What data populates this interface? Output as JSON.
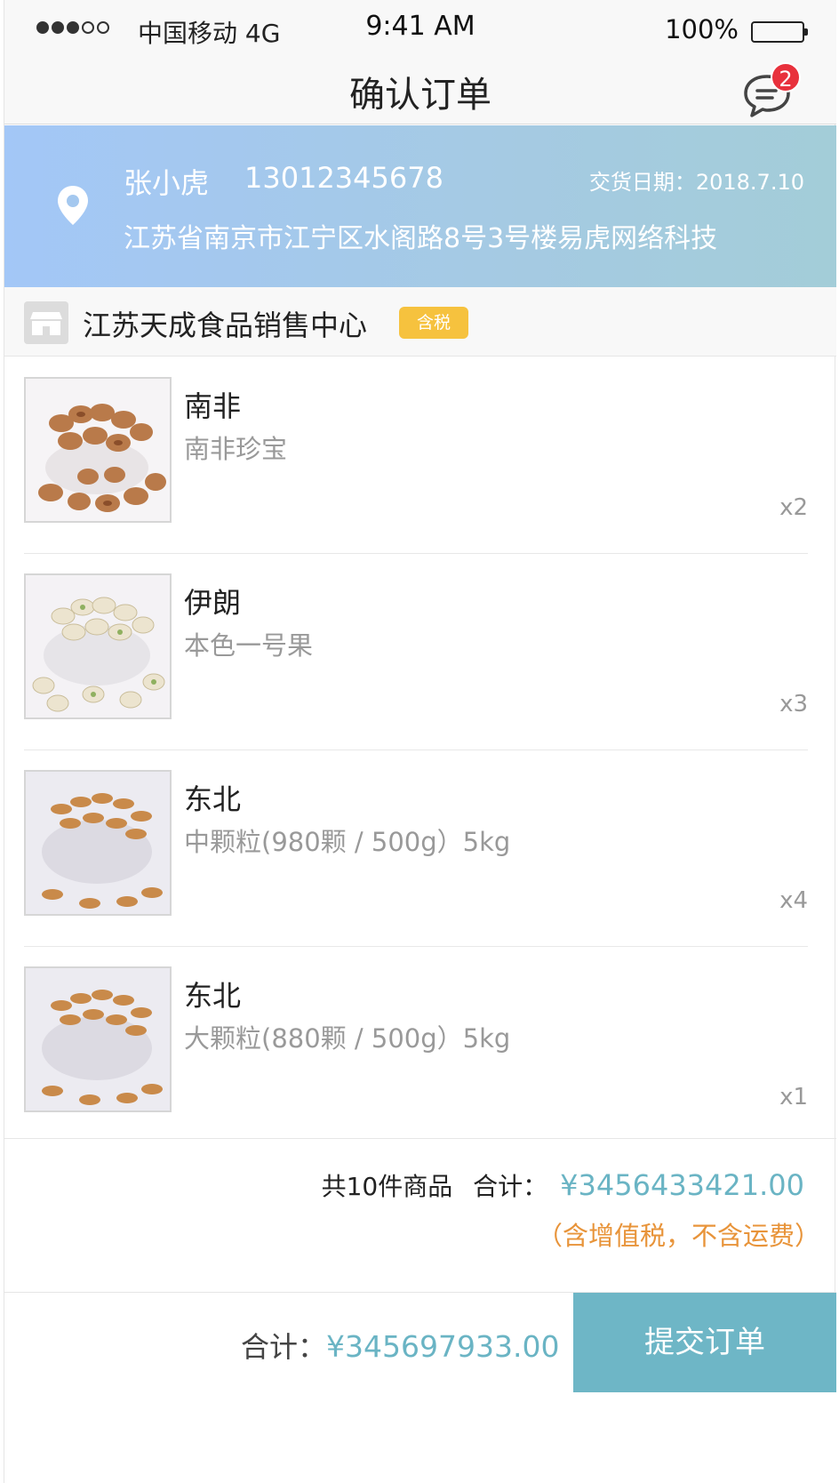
{
  "status_bar": {
    "carrier": "中国移动 4G",
    "time": "9:41 AM",
    "battery": "100%"
  },
  "nav": {
    "title": "确认订单",
    "message_badge": "2"
  },
  "address": {
    "name": "张小虎",
    "phone": "13012345678",
    "delivery_date": "交货日期：2018.7.10",
    "detail": "江苏省南京市江宁区水阁路8号3号楼易虎网络科技"
  },
  "shop": {
    "name": "江苏天成食品销售中心",
    "tax_badge": "含税"
  },
  "items": [
    {
      "name": "南非",
      "spec": "南非珍宝",
      "qty": "x2"
    },
    {
      "name": "伊朗",
      "spec": "本色一号果",
      "qty": "x3"
    },
    {
      "name": "东北",
      "spec": "中颗粒(980颗 / 500g）5kg",
      "qty": "x4"
    },
    {
      "name": "东北",
      "spec": "大颗粒(880颗 / 500g）5kg",
      "qty": "x1"
    }
  ],
  "summary": {
    "count_label": "共10件商品",
    "total_label": "合计：",
    "total_price": "¥3456433421.00",
    "note": "（含增值税，不含运费）"
  },
  "footer": {
    "total_label": "合计：",
    "total_price": "¥345697933.00",
    "submit_label": "提交订单"
  },
  "colors": {
    "accent": "#6eb6c6",
    "price": "#6ab4c4",
    "note": "#e8943a",
    "badge": "#e8313c",
    "tax_badge": "#f6c23e"
  },
  "icons": {
    "signal": "signal-dots-icon",
    "battery": "battery-icon",
    "message": "chat-bubble-icon",
    "location": "location-pin-icon",
    "shop": "store-icon",
    "product": "nut-bowl-image"
  }
}
